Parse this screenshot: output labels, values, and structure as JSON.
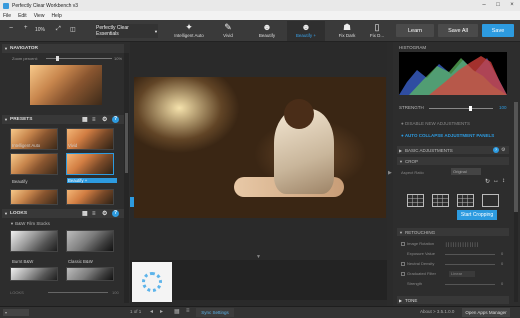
{
  "window": {
    "title": "Perfectly Clear Workbench v3"
  },
  "menu": [
    "File",
    "Edit",
    "View",
    "Help"
  ],
  "toolbar": {
    "zoom_minus": "−",
    "zoom_value": "10%",
    "zoom_plus": "+",
    "preset_selector": "Perfectly Clear Essentials",
    "presets": [
      {
        "label": "Intelligent Auto",
        "icon": "sparkle-icon"
      },
      {
        "label": "Vivid",
        "icon": "brush-icon"
      },
      {
        "label": "Beautify",
        "icon": "face-icon"
      },
      {
        "label": "Beautify +",
        "icon": "face-plus-icon"
      },
      {
        "label": "Fix Dark",
        "icon": "lamp-icon"
      },
      {
        "label": "Fix D...",
        "icon": "phone-icon"
      }
    ],
    "learn": "Learn",
    "save_all": "Save All",
    "save": "Save"
  },
  "left": {
    "navigator": {
      "title": "NAVIGATOR",
      "zoom_label": "Zoom percent:",
      "zoom_value": "10%"
    },
    "presets": {
      "title": "PRESETS",
      "items": [
        "Intelligent Auto",
        "Vivid",
        "Beautify",
        "Beautify +",
        "",
        ""
      ]
    },
    "looks": {
      "title": "LOOKS",
      "category": "B&W Film Stocks",
      "items": [
        "Burnt B&W",
        "Classic B&W"
      ],
      "footer_label": "LOOKS",
      "footer_value": "100"
    }
  },
  "bottom": {
    "page_info": "1 of 1",
    "sync": "Sync Settings",
    "about": "About > 3.5.1.0.0",
    "apps": "Open Apps Manager"
  },
  "right": {
    "histogram_title": "HISTOGRAM",
    "strength_label": "STRENGTH",
    "strength_value": "100",
    "disable_adj": "DISABLE NEW ADJUSTMENTS",
    "auto_collapse": "AUTO COLLAPSE ADJUSTMENT PANELS",
    "sections": {
      "basic": "BASIC ADJUSTMENTS",
      "crop": "CROP",
      "retouch": "RETOUCHING",
      "tone": "TONE"
    },
    "crop": {
      "aspect_label": "Aspect Ratio",
      "aspect_value": "Original",
      "start": "Start Cropping"
    },
    "retouch_rows": [
      {
        "label": "Image Rotation",
        "value": ""
      },
      {
        "label": "Exposure Value",
        "value": "0"
      },
      {
        "label": "Neutral Density",
        "value": "0"
      },
      {
        "label": "Graduated Filter",
        "value": "Linear"
      },
      {
        "label": "Strength",
        "value": "0"
      }
    ]
  }
}
